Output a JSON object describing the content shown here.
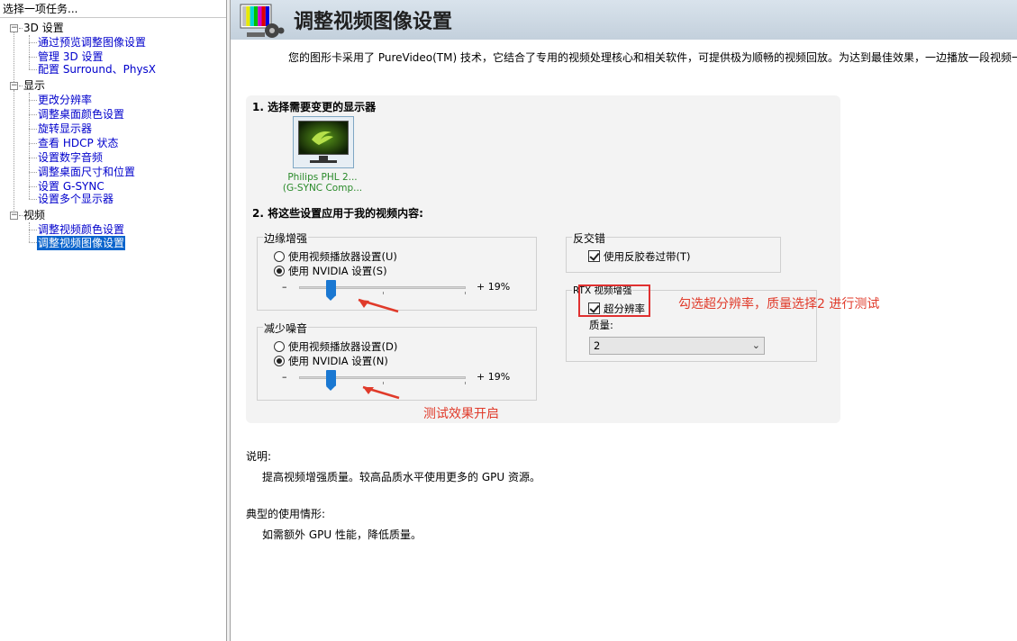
{
  "left_pane": {
    "title": "选择一项任务...",
    "categories": [
      {
        "label": "3D 设置",
        "items": [
          "通过预览调整图像设置",
          "管理 3D 设置",
          "配置 Surround、PhysX"
        ]
      },
      {
        "label": "显示",
        "items": [
          "更改分辨率",
          "调整桌面颜色设置",
          "旋转显示器",
          "查看 HDCP 状态",
          "设置数字音频",
          "调整桌面尺寸和位置",
          "设置 G-SYNC",
          "设置多个显示器"
        ]
      },
      {
        "label": "视频",
        "items": [
          "调整视频颜色设置",
          "调整视频图像设置"
        ]
      }
    ],
    "selected_item": "调整视频图像设置"
  },
  "page": {
    "title": "调整视频图像设置",
    "intro": "您的图形卡采用了 PureVideo(TM) 技术，它结合了专用的视频处理核心和相关软件，可提供极为顺畅的视频回放。为达到最佳效果，一边播放一段视频一"
  },
  "step1": {
    "label": "1. 选择需要变更的显示器",
    "monitor_name_line1": "Philips PHL 2...",
    "monitor_name_line2": "(G-SYNC Comp..."
  },
  "step2": {
    "label": "2. 将这些设置应用于我的视频内容:"
  },
  "edge_enhance": {
    "title": "边缘增强",
    "option_player": "使用视频播放器设置(U)",
    "option_nvidia": "使用 NVIDIA 设置(S)",
    "selected": "nvidia",
    "minus": "–",
    "value_label": "+ 19%",
    "value_percent": 19
  },
  "noise_reduce": {
    "title": "减少噪音",
    "option_player": "使用视频播放器设置(D)",
    "option_nvidia": "使用 NVIDIA 设置(N)",
    "selected": "nvidia",
    "minus": "–",
    "value_label": "+ 19%",
    "value_percent": 19
  },
  "deinterlace": {
    "title": "反交错",
    "option": "使用反胶卷过带(T)",
    "checked": true
  },
  "rtx": {
    "title": "RTX 视频增强",
    "super_res_label": "超分辨率",
    "super_res_checked": true,
    "quality_label": "质量:",
    "quality_value": "2"
  },
  "annotations": {
    "note_right": "勾选超分辨率，质量选择2  进行测试",
    "note_bottom": "测试效果开启",
    "color": "#e03a2a"
  },
  "description": {
    "label": "说明:",
    "text": "提高视频增强质量。较高品质水平使用更多的 GPU 资源。"
  },
  "usage": {
    "label": "典型的使用情形:",
    "text": "如需额外 GPU 性能，降低质量。"
  },
  "colors": {
    "accent_blue": "#1a78d2",
    "selection_blue": "#0a64cc",
    "nvidia_green": "#76b900"
  }
}
